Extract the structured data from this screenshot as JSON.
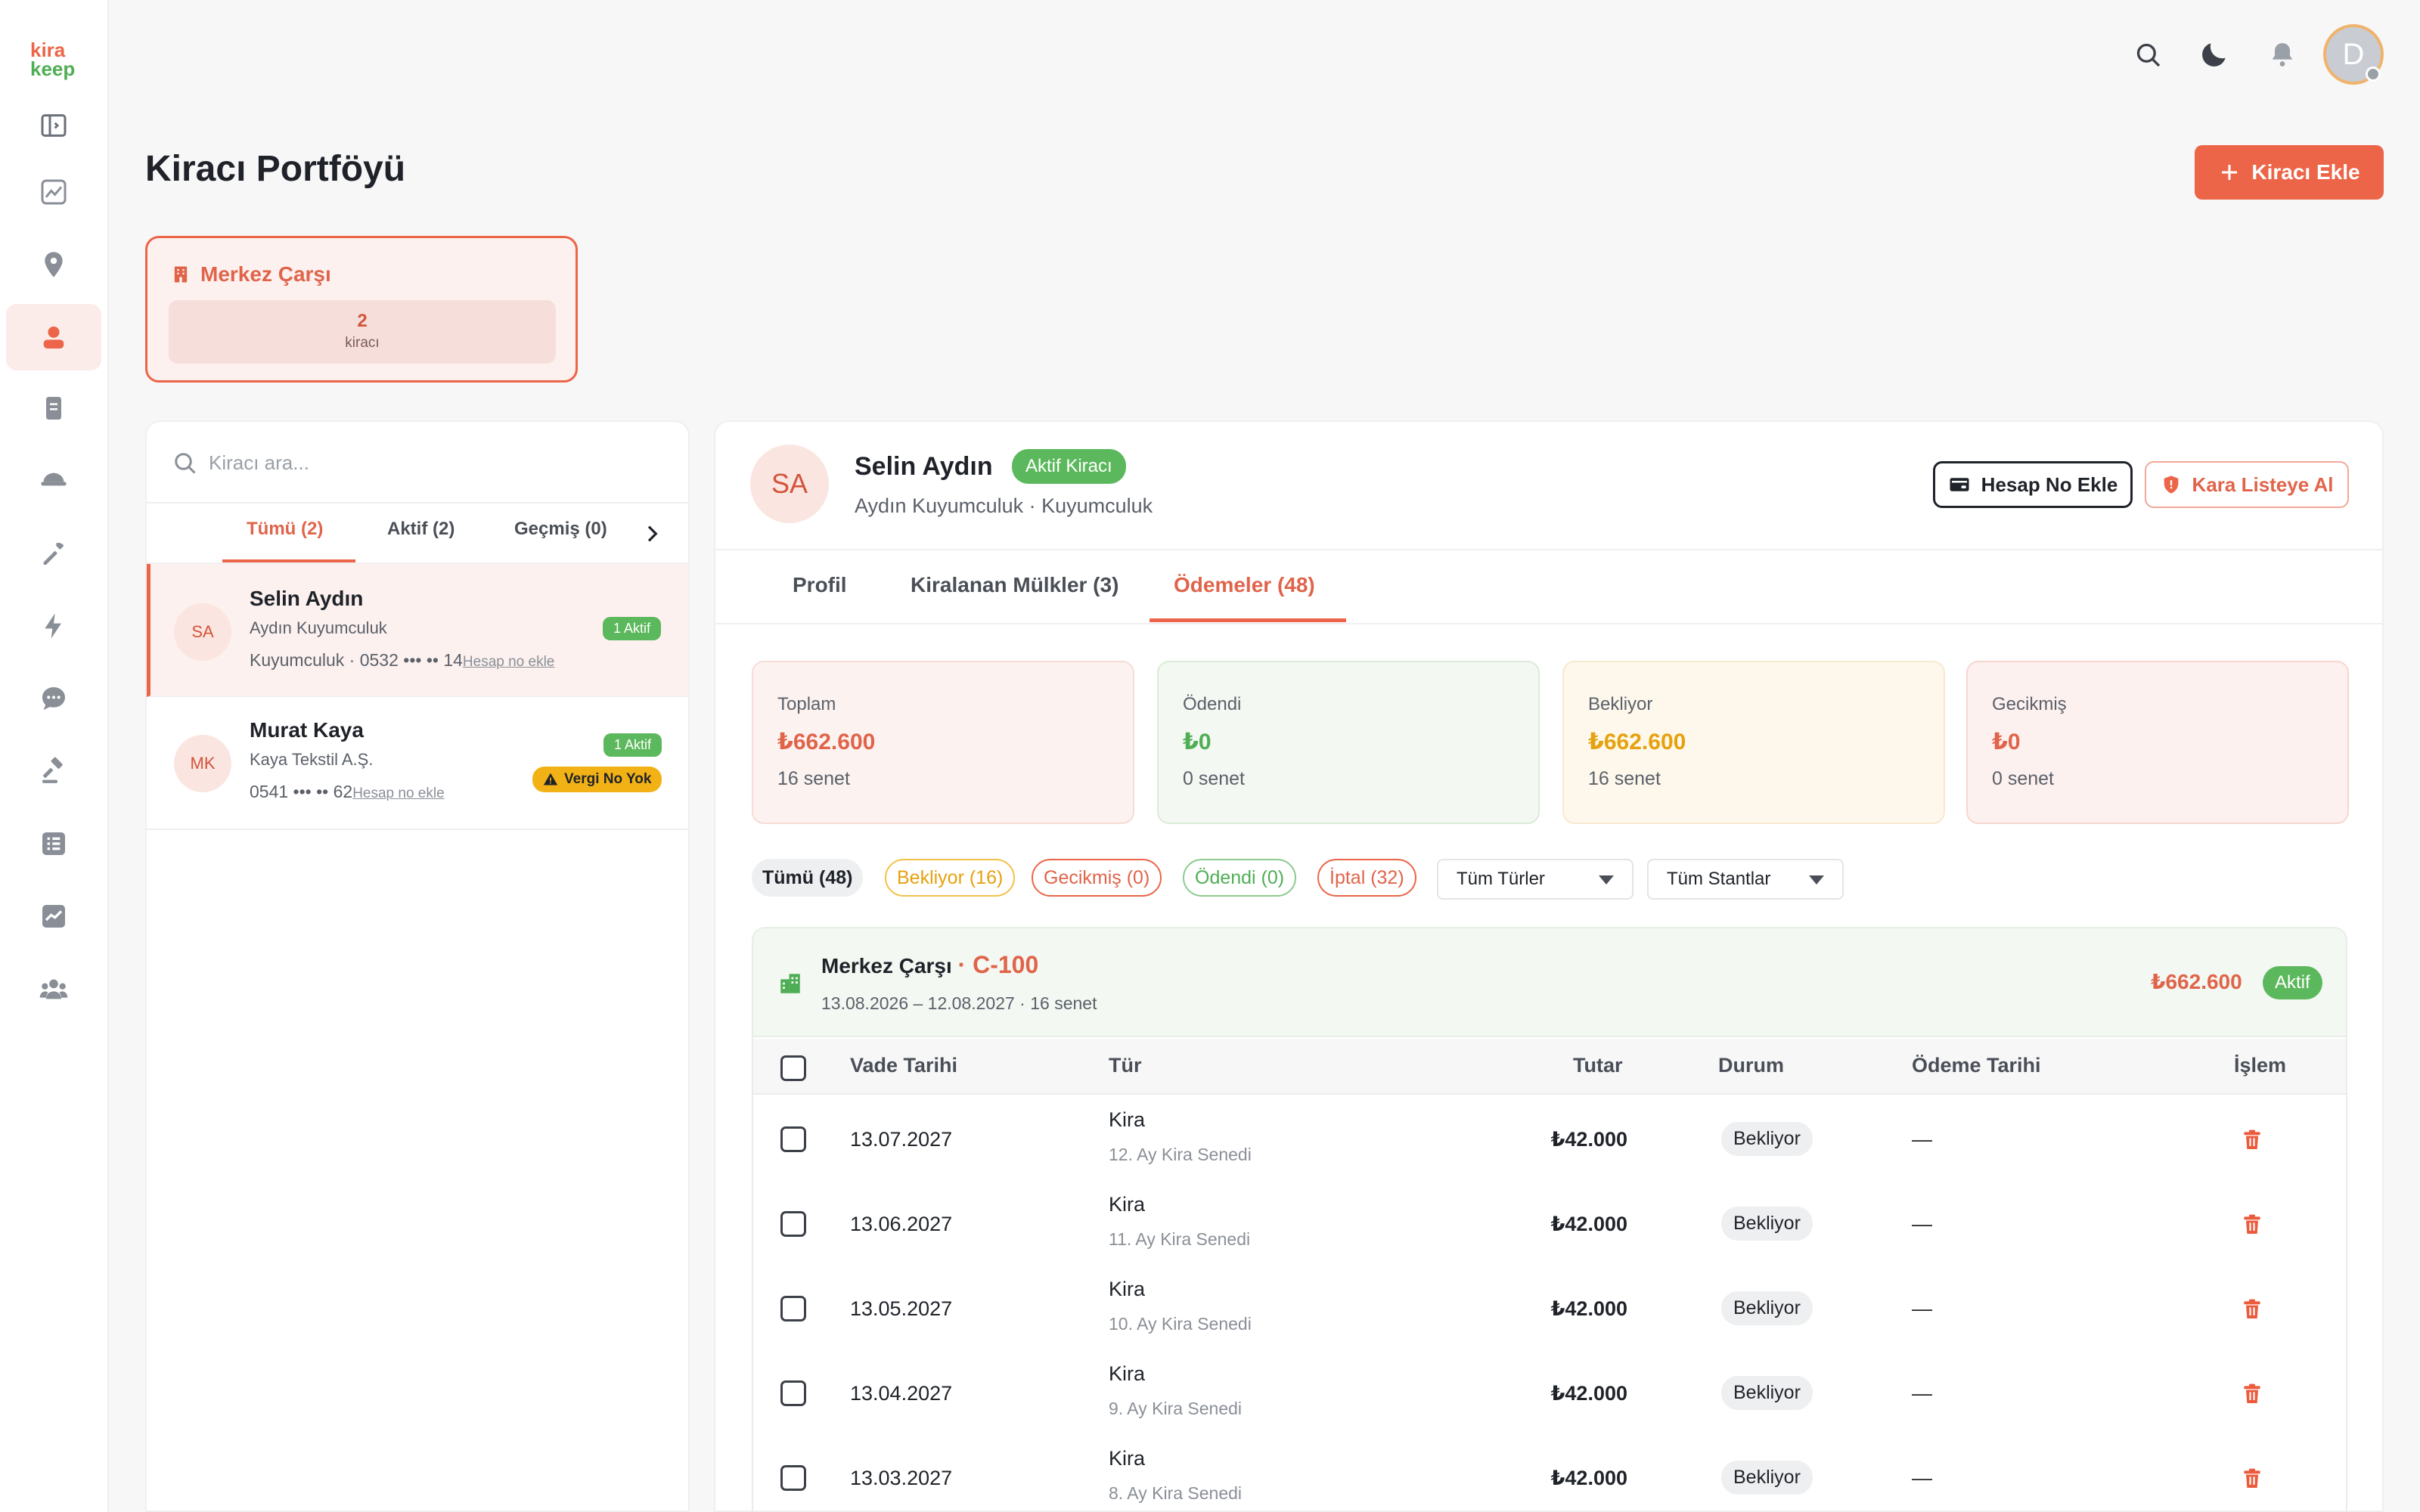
{
  "app": {
    "logo_top": "kira",
    "logo_bottom": "keep"
  },
  "sidebar": {
    "items": [
      {
        "icon": "sidebar-toggle-icon"
      },
      {
        "icon": "chart-icon"
      },
      {
        "icon": "location-pin-icon"
      },
      {
        "icon": "tenant-icon",
        "active": true
      },
      {
        "icon": "document-icon"
      },
      {
        "icon": "hat-icon"
      },
      {
        "icon": "tools-icon"
      },
      {
        "icon": "lightning-icon"
      },
      {
        "icon": "chat-icon"
      },
      {
        "icon": "gavel-icon"
      },
      {
        "icon": "list-icon"
      },
      {
        "icon": "trend-icon"
      },
      {
        "icon": "users-icon"
      }
    ]
  },
  "topbar": {
    "avatar_initial": "D"
  },
  "page": {
    "title": "Kiracı Portföyü",
    "add_button": "Kiracı Ekle"
  },
  "property": {
    "name": "Merkez Çarşı",
    "count": "2",
    "count_label": "kiracı"
  },
  "left": {
    "search_placeholder": "Kiracı ara...",
    "tabs": [
      "Tümü (2)",
      "Aktif (2)",
      "Geçmiş (0)"
    ],
    "tenants": [
      {
        "initials": "SA",
        "name": "Selin Aydın",
        "company": "Aydın Kuyumculuk",
        "meta": "Kuyumculuk · 0532 ••• •• 14",
        "link": "Hesap no ekle",
        "badge": "1 Aktif"
      },
      {
        "initials": "MK",
        "name": "Murat Kaya",
        "company": "Kaya Tekstil A.Ş.",
        "meta": "0541 ••• •• 62",
        "link": "Hesap no ekle",
        "badge": "1 Aktif",
        "warning": "Vergi No Yok"
      }
    ]
  },
  "detail": {
    "initials": "SA",
    "name": "Selin Aydın",
    "status": "Aktif Kiracı",
    "subtitle": "Aydın Kuyumculuk · Kuyumculuk",
    "btn_account": "Hesap No Ekle",
    "btn_blacklist": "Kara Listeye Al",
    "tabs": [
      "Profil",
      "Kiralanan Mülkler (3)",
      "Ödemeler (48)"
    ],
    "stats": [
      {
        "label": "Toplam",
        "value": "₺662.600",
        "sub": "16 senet",
        "color": "#e0644a"
      },
      {
        "label": "Ödendi",
        "value": "₺0",
        "sub": "0 senet",
        "color": "#4fae55"
      },
      {
        "label": "Bekliyor",
        "value": "₺662.600",
        "sub": "16 senet",
        "color": "#e6a10f"
      },
      {
        "label": "Gecikmiş",
        "value": "₺0",
        "sub": "0 senet",
        "color": "#e0644a"
      }
    ],
    "filters": [
      "Tümü (48)",
      "Bekliyor (16)",
      "Gecikmiş (0)",
      "Ödendi (0)",
      "İptal (32)"
    ],
    "dropdowns": [
      "Tüm Türler",
      "Tüm Stantlar"
    ],
    "lease": {
      "property": "Merkez Çarşı",
      "unit": "· C-100",
      "dates": "13.08.2026 – 12.08.2027 · 16 senet",
      "total": "₺662.600",
      "status": "Aktif"
    },
    "table": {
      "headers": [
        "Vade Tarihi",
        "Tür",
        "Tutar",
        "Durum",
        "Ödeme Tarihi",
        "İşlem"
      ],
      "rows": [
        {
          "due": "13.07.2027",
          "type": "Kira",
          "type_sub": "12. Ay Kira Senedi",
          "amount": "₺42.000",
          "status": "Bekliyor",
          "paid": "—"
        },
        {
          "due": "13.06.2027",
          "type": "Kira",
          "type_sub": "11. Ay Kira Senedi",
          "amount": "₺42.000",
          "status": "Bekliyor",
          "paid": "—"
        },
        {
          "due": "13.05.2027",
          "type": "Kira",
          "type_sub": "10. Ay Kira Senedi",
          "amount": "₺42.000",
          "status": "Bekliyor",
          "paid": "—"
        },
        {
          "due": "13.04.2027",
          "type": "Kira",
          "type_sub": "9. Ay Kira Senedi",
          "amount": "₺42.000",
          "status": "Bekliyor",
          "paid": "—"
        },
        {
          "due": "13.03.2027",
          "type": "Kira",
          "type_sub": "8. Ay Kira Senedi",
          "amount": "₺42.000",
          "status": "Bekliyor",
          "paid": "—"
        }
      ]
    }
  }
}
